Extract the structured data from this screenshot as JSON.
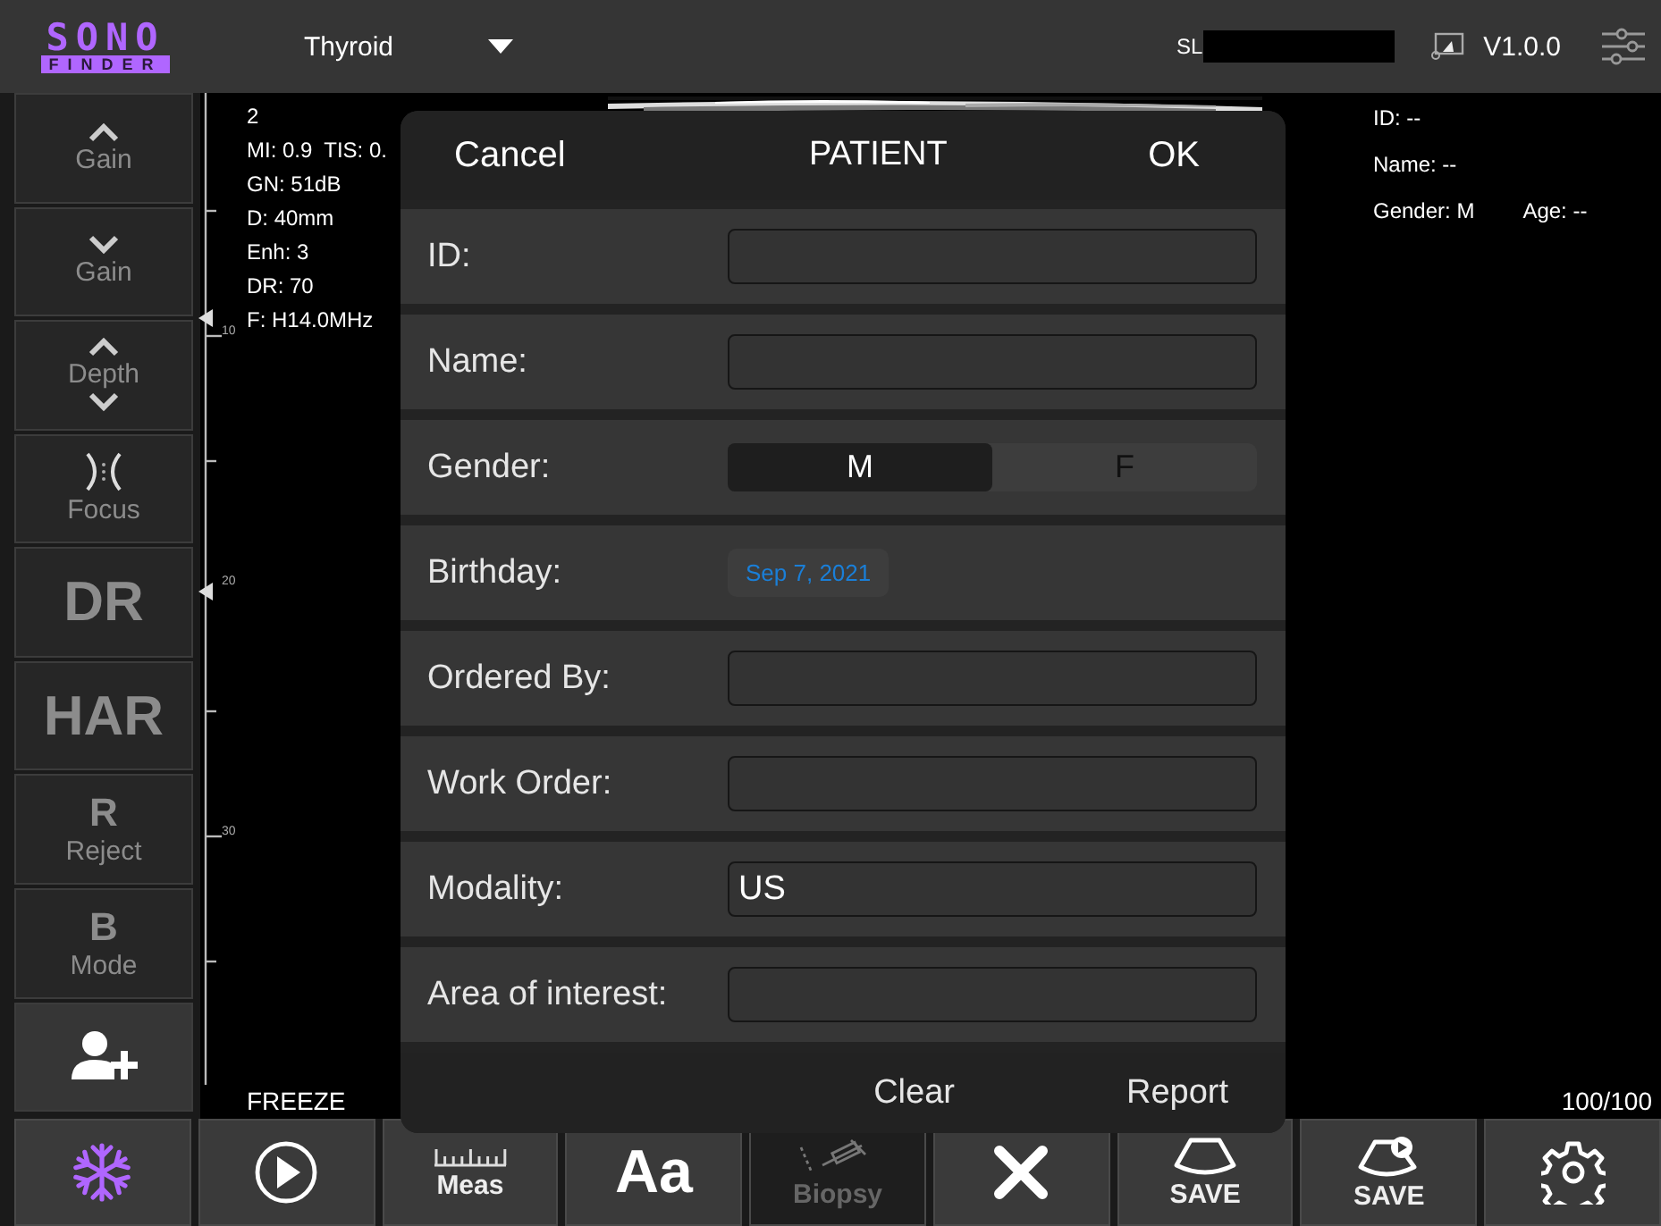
{
  "top_bar": {
    "logo_top": "SONO",
    "logo_bottom": "FINDER",
    "preset": "Thyroid",
    "serial_prefix": "SL",
    "version": "V1.0.0"
  },
  "left_buttons": [
    {
      "kind": "caret-up",
      "label": "Gain"
    },
    {
      "kind": "caret-down",
      "label": "Gain"
    },
    {
      "kind": "depth",
      "label": "Depth"
    },
    {
      "kind": "focus",
      "label": "Focus"
    },
    {
      "kind": "big",
      "label": "DR"
    },
    {
      "kind": "big",
      "label": "HAR"
    },
    {
      "kind": "letter",
      "letter": "R",
      "label": "Reject"
    },
    {
      "kind": "letter",
      "letter": "B",
      "label": "Mode"
    },
    {
      "kind": "add-user"
    }
  ],
  "image_area": {
    "params": [
      "2",
      "MI: 0.9  TIS: 0.",
      "GN: 51dB",
      "D: 40mm",
      "Enh: 3",
      "DR: 70",
      "F: H14.0MHz"
    ],
    "scale_labels": [
      "10",
      "20",
      "30"
    ],
    "patient_info": [
      [
        "ID: --"
      ],
      [
        "Name: --"
      ],
      [
        "Gender: M",
        "Age: --"
      ]
    ],
    "status": "FREEZE",
    "frames": "100/100"
  },
  "patient_dialog": {
    "cancel": "Cancel",
    "title": "PATIENT",
    "ok": "OK",
    "rows": [
      {
        "kind": "field",
        "label": "ID:"
      },
      {
        "kind": "field",
        "label": "Name:"
      },
      {
        "kind": "segmented",
        "label": "Gender:",
        "options": [
          {
            "label": "M",
            "selected": true
          },
          {
            "label": "F",
            "selected": false
          }
        ]
      },
      {
        "kind": "date",
        "label": "Birthday:",
        "value": "Sep 7, 2021"
      },
      {
        "kind": "field",
        "label": "Ordered By:"
      },
      {
        "kind": "field",
        "label": "Work Order:"
      },
      {
        "kind": "field",
        "label": "Modality:",
        "value": "US"
      },
      {
        "kind": "field",
        "label": "Area of interest:"
      }
    ],
    "footer": [
      "Clear",
      "Report"
    ]
  },
  "bottom_buttons": [
    {
      "kind": "snowflake",
      "disabled": false
    },
    {
      "kind": "play",
      "disabled": false
    },
    {
      "kind": "ruler",
      "label": "Meas",
      "disabled": false
    },
    {
      "kind": "big",
      "label": "Aa",
      "disabled": false
    },
    {
      "kind": "syringe",
      "label": "Biopsy",
      "disabled": true
    },
    {
      "kind": "x",
      "disabled": false
    },
    {
      "kind": "probe",
      "label": "SAVE",
      "disabled": false
    },
    {
      "kind": "probe-video",
      "label": "SAVE",
      "disabled": false
    },
    {
      "kind": "gear",
      "disabled": false
    }
  ]
}
